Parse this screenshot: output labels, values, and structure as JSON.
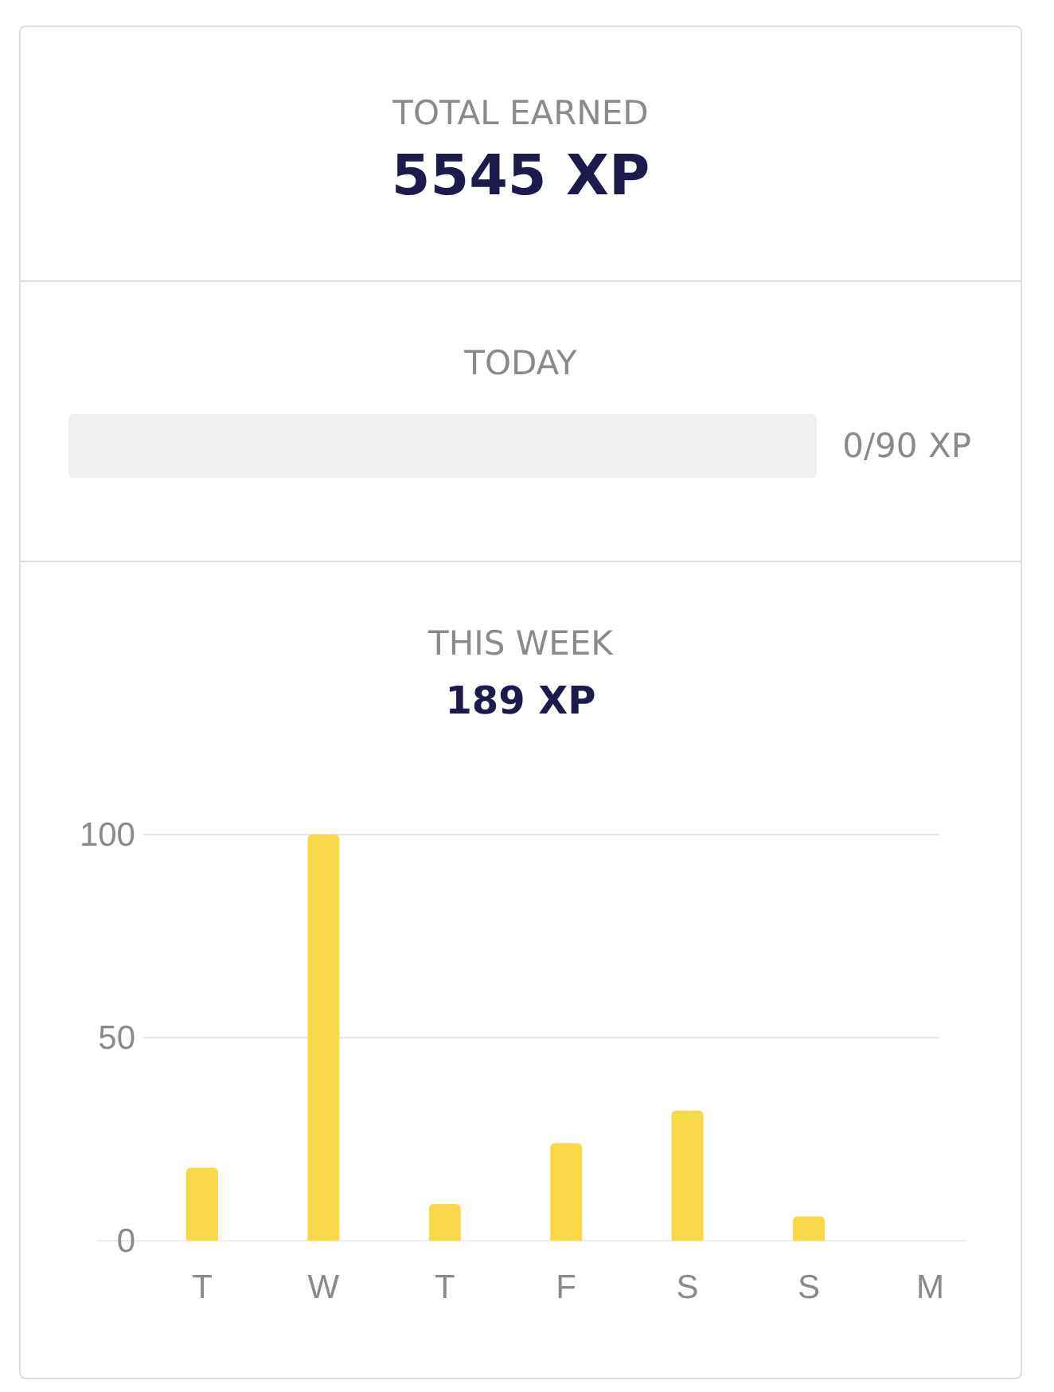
{
  "total_earned": {
    "label": "TOTAL EARNED",
    "value": "5545 XP"
  },
  "today": {
    "label": "TODAY",
    "level": 0,
    "reading": "0/90 XP"
  },
  "this_week": {
    "label": "THIS WEEK",
    "value": "189 XP",
    "chart_data": {
      "type": "bar",
      "categories": [
        "T",
        "W",
        "T",
        "F",
        "S",
        "S",
        "M"
      ],
      "series": [
        {
          "color": "#f9d949",
          "values": [
            18,
            100,
            9,
            24,
            32,
            6,
            0
          ]
        }
      ],
      "ylim": [
        0,
        100
      ],
      "yticks": [
        0,
        50,
        100
      ]
    }
  }
}
